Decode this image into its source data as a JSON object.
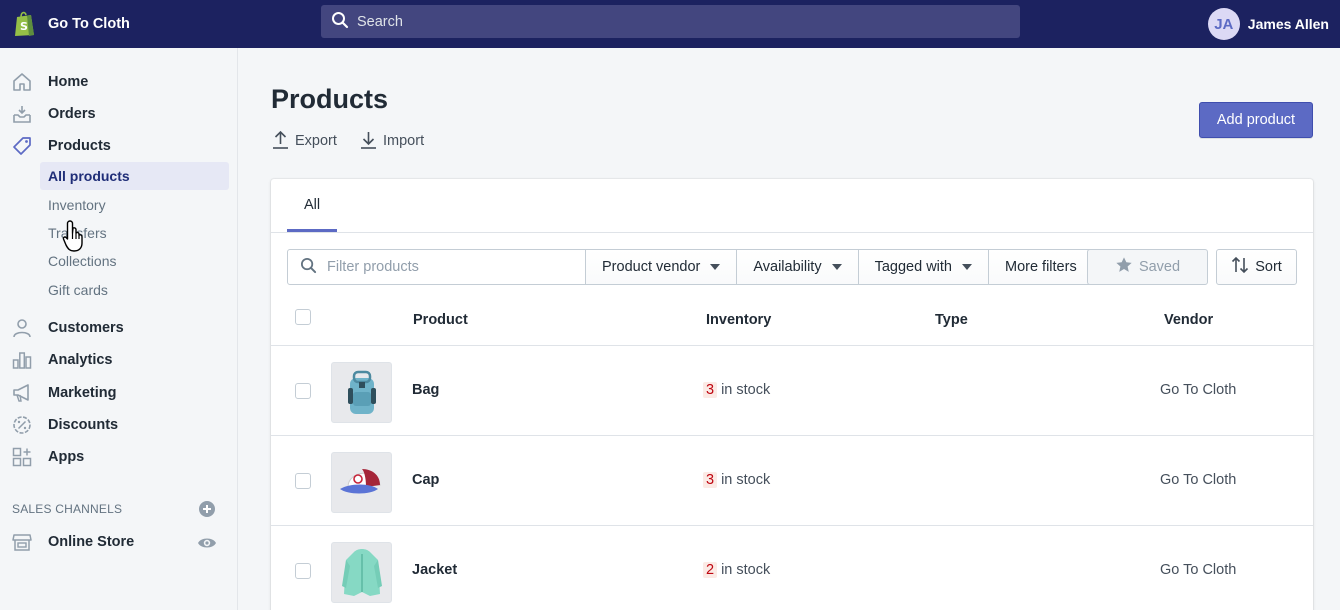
{
  "app": {
    "store_name": "Go To Cloth",
    "brand_color": "#1c2260",
    "accent": "#5c6ac4"
  },
  "search": {
    "placeholder": "Search"
  },
  "user": {
    "initials": "JA",
    "name": "James Allen"
  },
  "sidebar": {
    "items": [
      {
        "label": "Home",
        "icon": "home-icon"
      },
      {
        "label": "Orders",
        "icon": "orders-icon"
      },
      {
        "label": "Products",
        "icon": "tag-icon"
      },
      {
        "label": "Customers",
        "icon": "person-icon"
      },
      {
        "label": "Analytics",
        "icon": "bar-chart-icon"
      },
      {
        "label": "Marketing",
        "icon": "megaphone-icon"
      },
      {
        "label": "Discounts",
        "icon": "discount-icon"
      },
      {
        "label": "Apps",
        "icon": "apps-icon"
      }
    ],
    "product_sub": [
      "All products",
      "Inventory",
      "Transfers",
      "Collections",
      "Gift cards"
    ],
    "sales_channels_heading": "SALES CHANNELS",
    "online_store": "Online Store"
  },
  "page": {
    "title": "Products",
    "export_label": "Export",
    "import_label": "Import",
    "add_button": "Add product"
  },
  "tabs": [
    {
      "label": "All",
      "selected": true
    }
  ],
  "filters": {
    "placeholder": "Filter products",
    "buttons": [
      "Product vendor",
      "Availability",
      "Tagged with",
      "More filters"
    ],
    "saved": "Saved",
    "sort": "Sort"
  },
  "table": {
    "columns": [
      "Product",
      "Inventory",
      "Type",
      "Vendor"
    ],
    "rows": [
      {
        "name": "Bag",
        "stock_count": "3",
        "stock_suffix": "in stock",
        "type": "",
        "vendor": "Go To Cloth"
      },
      {
        "name": "Cap",
        "stock_count": "3",
        "stock_suffix": "in stock",
        "type": "",
        "vendor": "Go To Cloth"
      },
      {
        "name": "Jacket",
        "stock_count": "2",
        "stock_suffix": "in stock",
        "type": "",
        "vendor": "Go To Cloth"
      }
    ]
  }
}
